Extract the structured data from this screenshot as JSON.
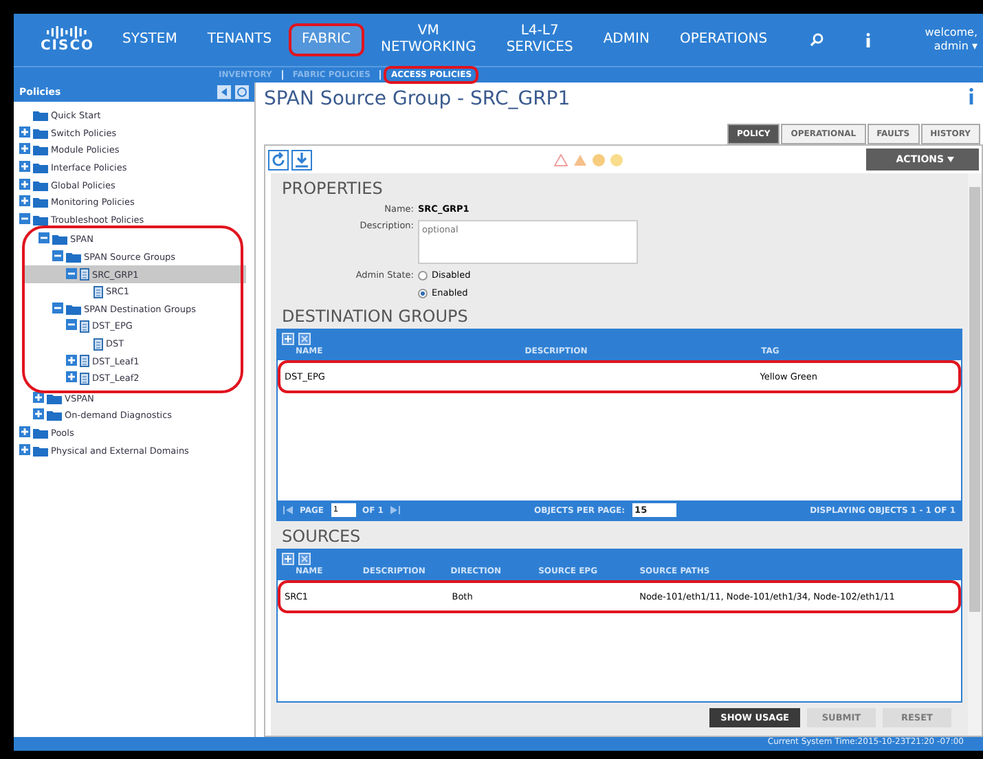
{
  "nav": {
    "logo": "CISCO",
    "items": [
      {
        "label": "SYSTEM",
        "selected": false,
        "highlighted": false
      },
      {
        "label": "TENANTS",
        "selected": false,
        "highlighted": false
      },
      {
        "label": "FABRIC",
        "selected": true,
        "highlighted": true
      },
      {
        "label": "VM NETWORKING",
        "selected": false,
        "highlighted": false
      },
      {
        "label": "L4-L7 SERVICES",
        "selected": false,
        "highlighted": false
      },
      {
        "label": "ADMIN",
        "selected": false,
        "highlighted": false
      },
      {
        "label": "OPERATIONS",
        "selected": false,
        "highlighted": false
      }
    ],
    "user": "welcome,",
    "user_name": "admin ▾"
  },
  "subnav": [
    {
      "label": "INVENTORY",
      "selected": false,
      "highlighted": false
    },
    {
      "label": "FABRIC POLICIES",
      "selected": false,
      "highlighted": false
    },
    {
      "label": "ACCESS POLICIES",
      "selected": true,
      "highlighted": true
    }
  ],
  "sidebar": {
    "title": "Policies",
    "tree": [
      {
        "label": "Quick Start",
        "kind": "folder",
        "selected": false
      },
      {
        "label": "Switch Policies",
        "kind": "folder",
        "expanded": false,
        "selected": false
      },
      {
        "label": "Module Policies",
        "kind": "folder",
        "expanded": false,
        "selected": false
      },
      {
        "label": "Interface Policies",
        "kind": "folder",
        "expanded": false,
        "selected": false
      },
      {
        "label": "Global Policies",
        "kind": "folder",
        "expanded": false,
        "selected": false
      },
      {
        "label": "Monitoring Policies",
        "kind": "folder",
        "expanded": false,
        "selected": false
      },
      {
        "label": "Troubleshoot Policies",
        "kind": "folder",
        "expanded": true,
        "selected": false,
        "children": [
          {
            "label": "SPAN",
            "kind": "folder",
            "expanded": true,
            "selected": false,
            "highlighted": true,
            "children": [
              {
                "label": "SPAN Source Groups",
                "kind": "folder",
                "expanded": true,
                "selected": false,
                "children": [
                  {
                    "label": "SRC_GRP1",
                    "kind": "doc",
                    "expanded": true,
                    "selected": true,
                    "children": [
                      {
                        "label": "SRC1",
                        "kind": "doc",
                        "selected": false
                      }
                    ]
                  }
                ]
              },
              {
                "label": "SPAN Destination Groups",
                "kind": "folder",
                "expanded": true,
                "selected": false,
                "children": [
                  {
                    "label": "DST_EPG",
                    "kind": "doc",
                    "expanded": true,
                    "selected": false,
                    "children": [
                      {
                        "label": "DST",
                        "kind": "doc",
                        "selected": false
                      }
                    ]
                  },
                  {
                    "label": "DST_Leaf1",
                    "kind": "doc",
                    "expanded": false,
                    "selected": false
                  },
                  {
                    "label": "DST_Leaf2",
                    "kind": "doc",
                    "expanded": false,
                    "selected": false
                  }
                ]
              }
            ]
          },
          {
            "label": "VSPAN",
            "kind": "folder",
            "expanded": false,
            "selected": false
          },
          {
            "label": "On-demand Diagnostics",
            "kind": "folder",
            "expanded": false,
            "selected": false
          }
        ]
      },
      {
        "label": "Pools",
        "kind": "folder",
        "expanded": false,
        "selected": false
      },
      {
        "label": "Physical and External Domains",
        "kind": "folder",
        "expanded": false,
        "selected": false
      }
    ]
  },
  "main": {
    "title": "SPAN Source Group - SRC_GRP1",
    "tabs": [
      {
        "label": "POLICY",
        "selected": true
      },
      {
        "label": "OPERATIONAL",
        "selected": false
      },
      {
        "label": "FAULTS",
        "selected": false
      },
      {
        "label": "HISTORY",
        "selected": false
      }
    ],
    "actions": "ACTIONS",
    "properties": {
      "heading": "PROPERTIES",
      "name_label": "Name:",
      "name": "SRC_GRP1",
      "description_label": "Description:",
      "description_placeholder": "optional",
      "admin_state_label": "Admin State:",
      "admin_states": [
        {
          "label": "Disabled",
          "selected": false
        },
        {
          "label": "Enabled",
          "selected": true
        }
      ]
    },
    "destination_groups": {
      "heading": "DESTINATION GROUPS",
      "columns": [
        "NAME",
        "DESCRIPTION",
        "TAG"
      ],
      "rows": [
        {
          "cells": [
            "DST_EPG",
            "",
            "Yellow Green"
          ],
          "highlighted": true
        }
      ],
      "pager": {
        "page_label": "PAGE",
        "page": "1",
        "of": "OF 1",
        "per_page_label": "OBJECTS PER PAGE:",
        "per_page": "15",
        "displaying": "DISPLAYING OBJECTS 1 - 1 OF 1"
      }
    },
    "sources": {
      "heading": "SOURCES",
      "columns": [
        "NAME",
        "DESCRIPTION",
        "DIRECTION",
        "SOURCE EPG",
        "SOURCE PATHS"
      ],
      "rows": [
        {
          "cells": [
            "SRC1",
            "",
            "Both",
            "",
            "Node-101/eth1/11, Node-101/eth1/34, Node-102/eth1/11"
          ],
          "highlighted": true
        }
      ]
    },
    "buttons": [
      {
        "label": "SHOW USAGE",
        "disabled": false
      },
      {
        "label": "SUBMIT",
        "disabled": true
      },
      {
        "label": "RESET",
        "disabled": true
      }
    ]
  },
  "status_bar": "Current System Time:2015-10-23T21:20 -07:00"
}
